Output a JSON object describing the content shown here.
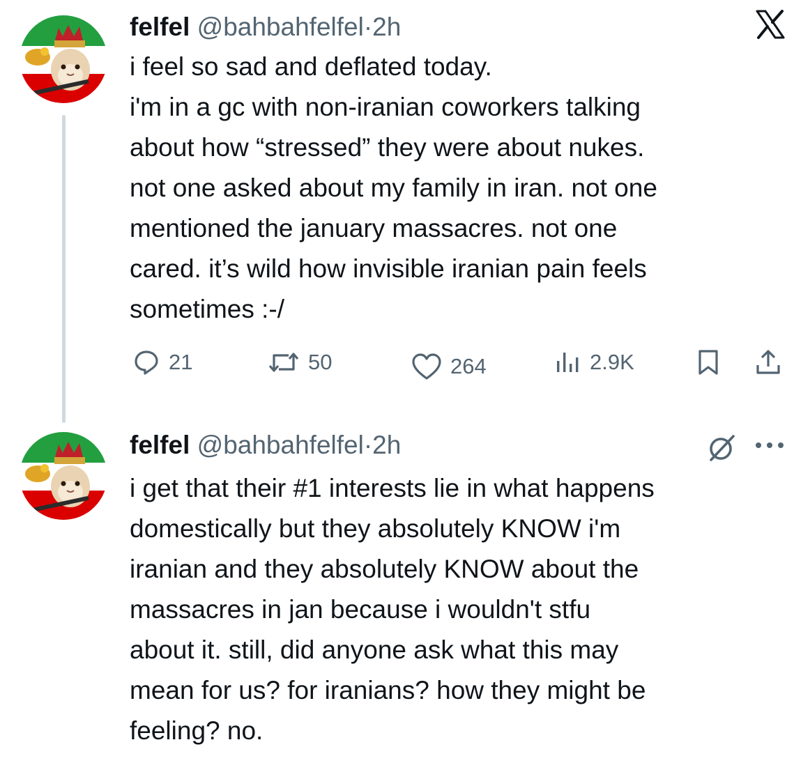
{
  "tweets": [
    {
      "author_name": "felfel",
      "handle": "@bahbahfelfel",
      "separator": "·",
      "time": "2h",
      "lines": [
        "i feel so sad and deflated today.",
        "i'm in a gc with non-iranian coworkers talking",
        "about how “stressed” they were about nukes.",
        "not one asked about my family in iran. not one",
        "mentioned the january massacres. not one",
        "cared. it’s wild how invisible iranian pain feels",
        "sometimes :-/"
      ],
      "metrics": {
        "replies": "21",
        "reposts": "50",
        "likes": "264",
        "views": "2.9K"
      }
    },
    {
      "author_name": "felfel",
      "handle": "@bahbahfelfel",
      "separator": "·",
      "time": "2h",
      "lines": [
        "i get that their #1 interests lie in what happens",
        "domestically but they absolutely KNOW i'm",
        "iranian and they absolutely KNOW about the",
        "massacres in jan because i wouldn't stfu",
        "about it. still, did anyone ask what this may",
        "mean for us? for iranians? how they might be",
        "feeling? no."
      ]
    }
  ],
  "icons": {
    "brand": "x-logo-icon",
    "reply": "reply-icon",
    "repost": "repost-icon",
    "like": "like-icon",
    "views": "views-icon",
    "bookmark": "bookmark-icon",
    "share": "share-icon",
    "grok": "grok-icon",
    "more": "more-icon"
  },
  "colors": {
    "text": "#0f1419",
    "secondary": "#536471",
    "thread_line": "#cfd9de"
  }
}
